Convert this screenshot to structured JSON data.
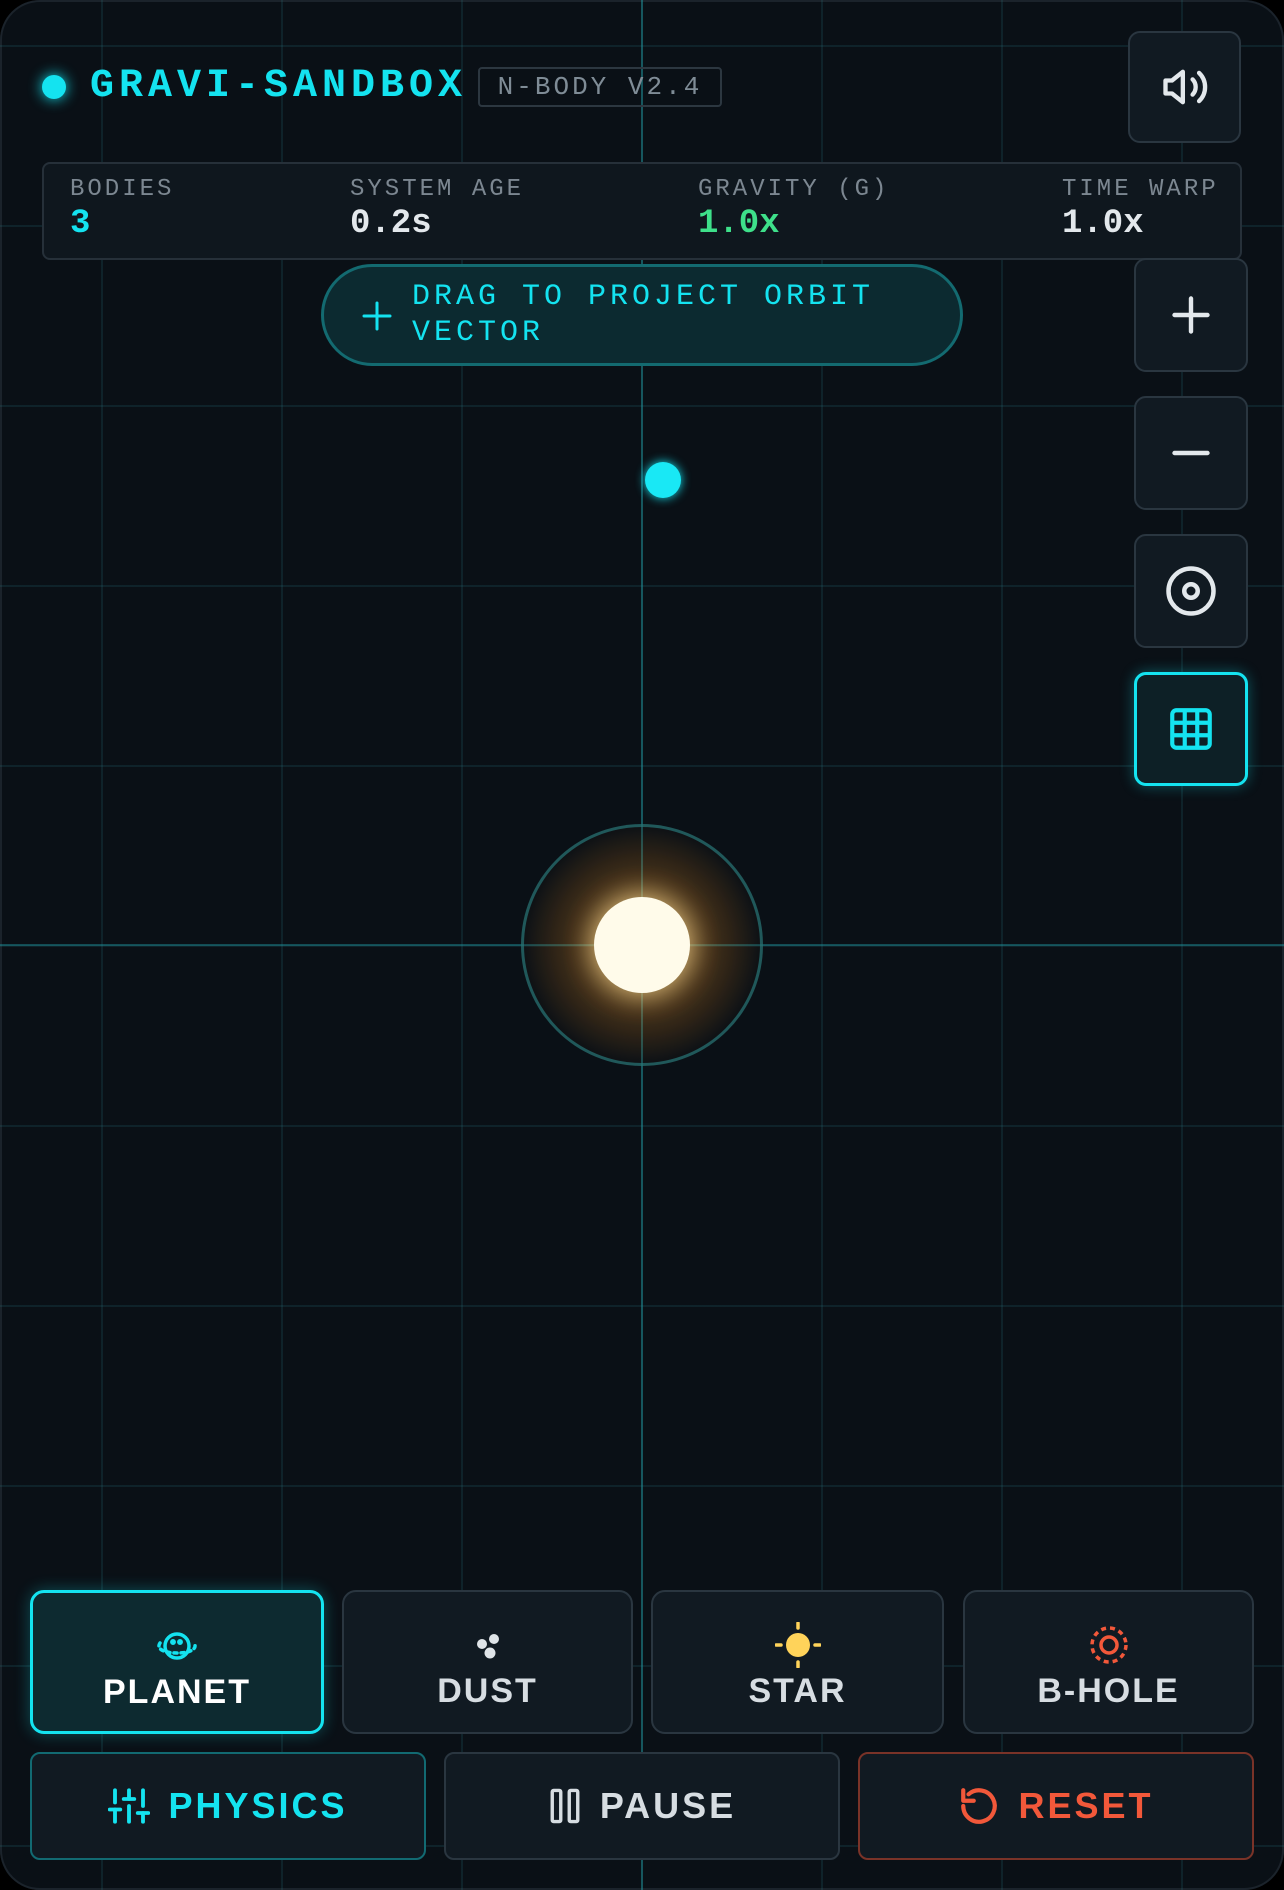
{
  "header": {
    "title": "GRAVI-SANDBOX",
    "version": "N-BODY V2.4",
    "status_color": "#14e3f0"
  },
  "stats": [
    {
      "label": "BODIES",
      "value": "3"
    },
    {
      "label": "SYSTEM AGE",
      "value": "0.2s"
    },
    {
      "label": "GRAVITY (G)",
      "value": "1.0x"
    },
    {
      "label": "TIME WARP",
      "value": "1.0x"
    }
  ],
  "hint": {
    "text": "DRAG TO PROJECT ORBIT VECTOR",
    "icon": "plus-icon"
  },
  "controls": {
    "sound_icon": "volume-icon",
    "zoom_in_icon": "plus-icon",
    "zoom_out_icon": "minus-icon",
    "recenter_icon": "target-icon",
    "grid_icon": "grid-icon",
    "grid_active": true
  },
  "tools": [
    {
      "label": "PLANET",
      "icon": "planet-icon",
      "active": true
    },
    {
      "label": "DUST",
      "icon": "dust-icon",
      "active": false
    },
    {
      "label": "STAR",
      "icon": "sun-icon",
      "active": false
    },
    {
      "label": "B-HOLE",
      "icon": "black-hole-icon",
      "active": false
    }
  ],
  "actions": [
    {
      "label": "PHYSICS",
      "icon": "sliders-icon"
    },
    {
      "label": "PAUSE",
      "icon": "pause-icon"
    },
    {
      "label": "RESET",
      "icon": "reset-icon"
    }
  ],
  "colors": {
    "accent": "#14e3f0",
    "gravity_value": "#3ee08a",
    "reset": "#f2583a",
    "star_icon": "#ffd35a",
    "background": "#0a1016"
  }
}
